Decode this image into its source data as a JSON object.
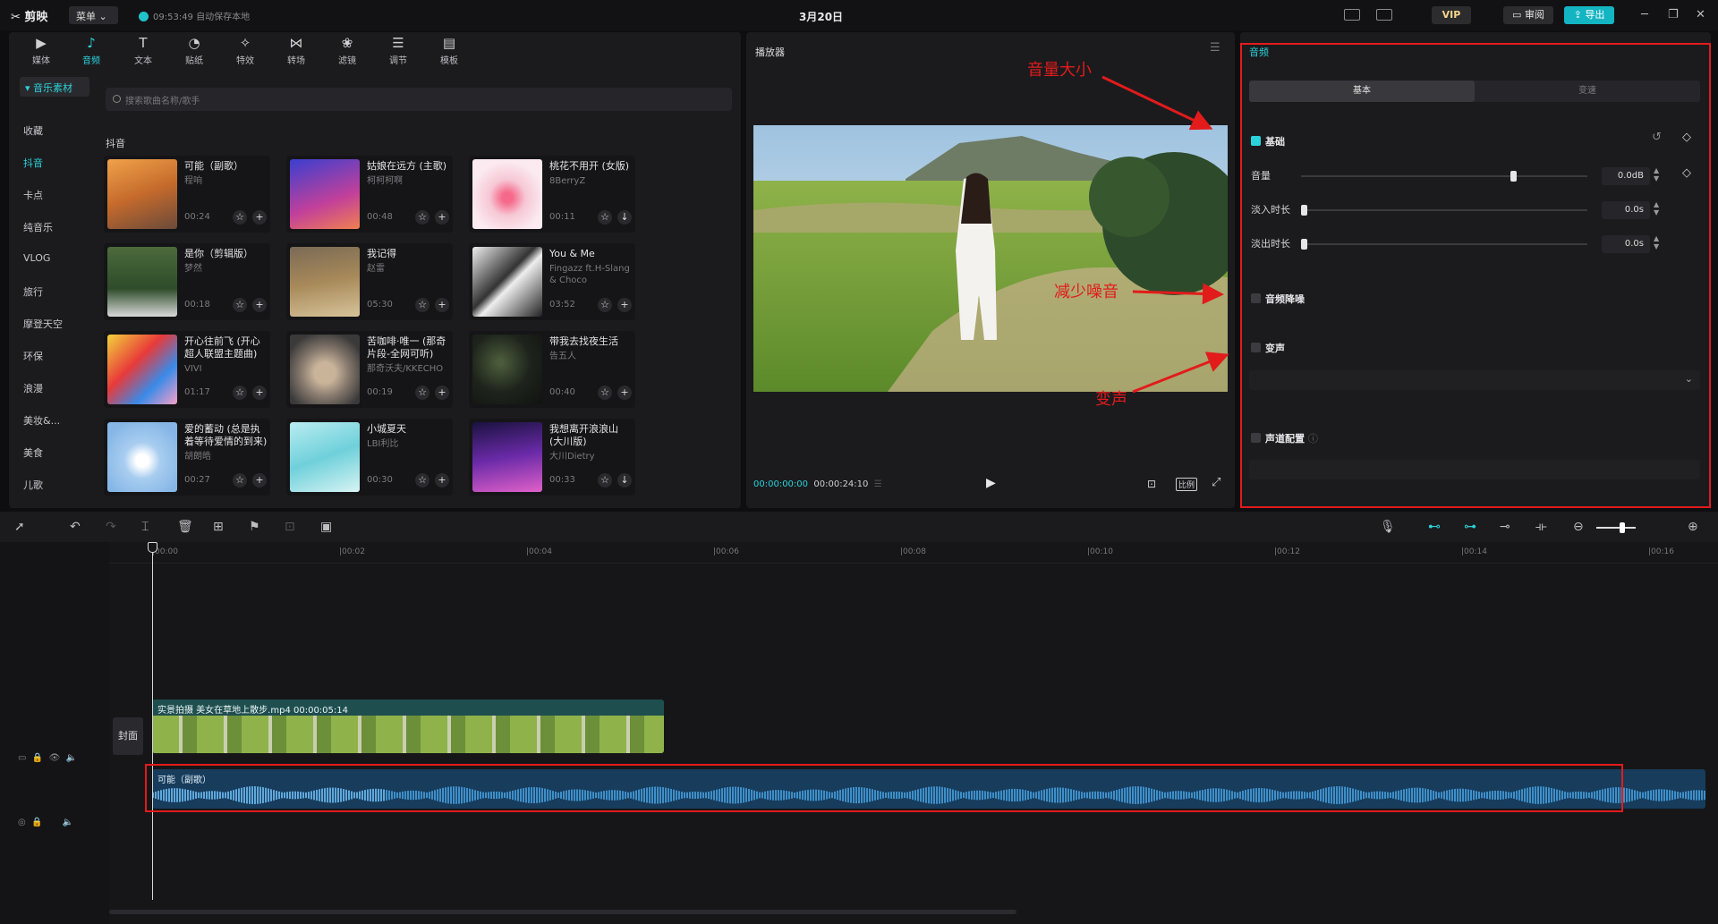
{
  "titlebar": {
    "app_name": "剪映",
    "menu_label": "菜单",
    "save_status": "09:53:49 自动保存本地",
    "project_title": "3月20日",
    "vip_label": "VIP",
    "review_label": "审阅",
    "export_label": "导出"
  },
  "tabs": [
    {
      "label": "媒体",
      "icon": "media-icon"
    },
    {
      "label": "音频",
      "icon": "audio-icon"
    },
    {
      "label": "文本",
      "icon": "text-icon"
    },
    {
      "label": "贴纸",
      "icon": "sticker-icon"
    },
    {
      "label": "特效",
      "icon": "effects-icon"
    },
    {
      "label": "转场",
      "icon": "transition-icon"
    },
    {
      "label": "滤镜",
      "icon": "filter-icon"
    },
    {
      "label": "调节",
      "icon": "adjust-icon"
    },
    {
      "label": "模板",
      "icon": "template-icon"
    }
  ],
  "library": {
    "section_head": "音乐素材",
    "categories": [
      "收藏",
      "抖音",
      "卡点",
      "纯音乐",
      "VLOG",
      "旅行",
      "摩登天空",
      "环保",
      "浪漫",
      "美妆&...",
      "美食",
      "儿歌"
    ],
    "search_placeholder": "搜索歌曲名称/歌手",
    "section_title": "抖音",
    "songs": [
      {
        "title": "可能（副歌）",
        "artist": "程响",
        "duration": "00:24"
      },
      {
        "title": "姑娘在远方 (主歌)",
        "artist": "柯柯柯啊",
        "duration": "00:48"
      },
      {
        "title": "桃花不用开 (女版)",
        "artist": "8BerryZ",
        "duration": "00:11"
      },
      {
        "title": "是你（剪辑版）",
        "artist": "梦然",
        "duration": "00:18"
      },
      {
        "title": "我记得",
        "artist": "赵雷",
        "duration": "05:30"
      },
      {
        "title": "You & Me",
        "artist": "Fingazz ft.H-Slang & Choco",
        "duration": "03:52"
      },
      {
        "title": "开心往前飞 (开心超人联盟主题曲)",
        "artist": "VIVI",
        "duration": "01:17"
      },
      {
        "title": "苦咖啡·唯一 (那奇片段-全网可听)",
        "artist": "那奇沃夫/KKECHO",
        "duration": "00:19"
      },
      {
        "title": "带我去找夜生活",
        "artist": "告五人",
        "duration": "00:40"
      },
      {
        "title": "爱的蓄动 (总是执着等待爱情的到来)",
        "artist": "胡朗皓",
        "duration": "00:27"
      },
      {
        "title": "小城夏天",
        "artist": "LBI利比",
        "duration": "00:30"
      },
      {
        "title": "我想离开浪浪山 (大川版)",
        "artist": "大川Dietry",
        "duration": "00:33"
      }
    ]
  },
  "player": {
    "title": "播放器",
    "current_time": "00:00:00:00",
    "total_time": "00:00:24:10",
    "ratio_label": "比例"
  },
  "props": {
    "title": "音频",
    "tab_basic": "基本",
    "tab_speed": "变速",
    "basic_label": "基础",
    "volume_label": "音量",
    "volume_value": "0.0dB",
    "volume_level": 0.74,
    "fadein_label": "淡入时长",
    "fadein_value": "0.0s",
    "fadeout_label": "淡出时长",
    "fadeout_value": "0.0s",
    "denoise_label": "音频降噪",
    "voice_label": "变声",
    "channel_label": "声道配置"
  },
  "timeline": {
    "ticks": [
      "00:00",
      "00:02",
      "00:04",
      "00:06",
      "00:08",
      "00:10",
      "00:12",
      "00:14",
      "00:16"
    ],
    "cover_label": "封面",
    "video_clip_label": "实景拍摄 美女在草地上散步.mp4  00:00:05:14",
    "audio_clip_label": "可能（副歌）"
  },
  "annotations": {
    "volume": "音量大小",
    "denoise": "减少噪音",
    "voice": "变声"
  },
  "colors": {
    "accent": "#2bd2d9",
    "annotation_red": "#e21b1b",
    "export_bg": "#14b5c2"
  }
}
